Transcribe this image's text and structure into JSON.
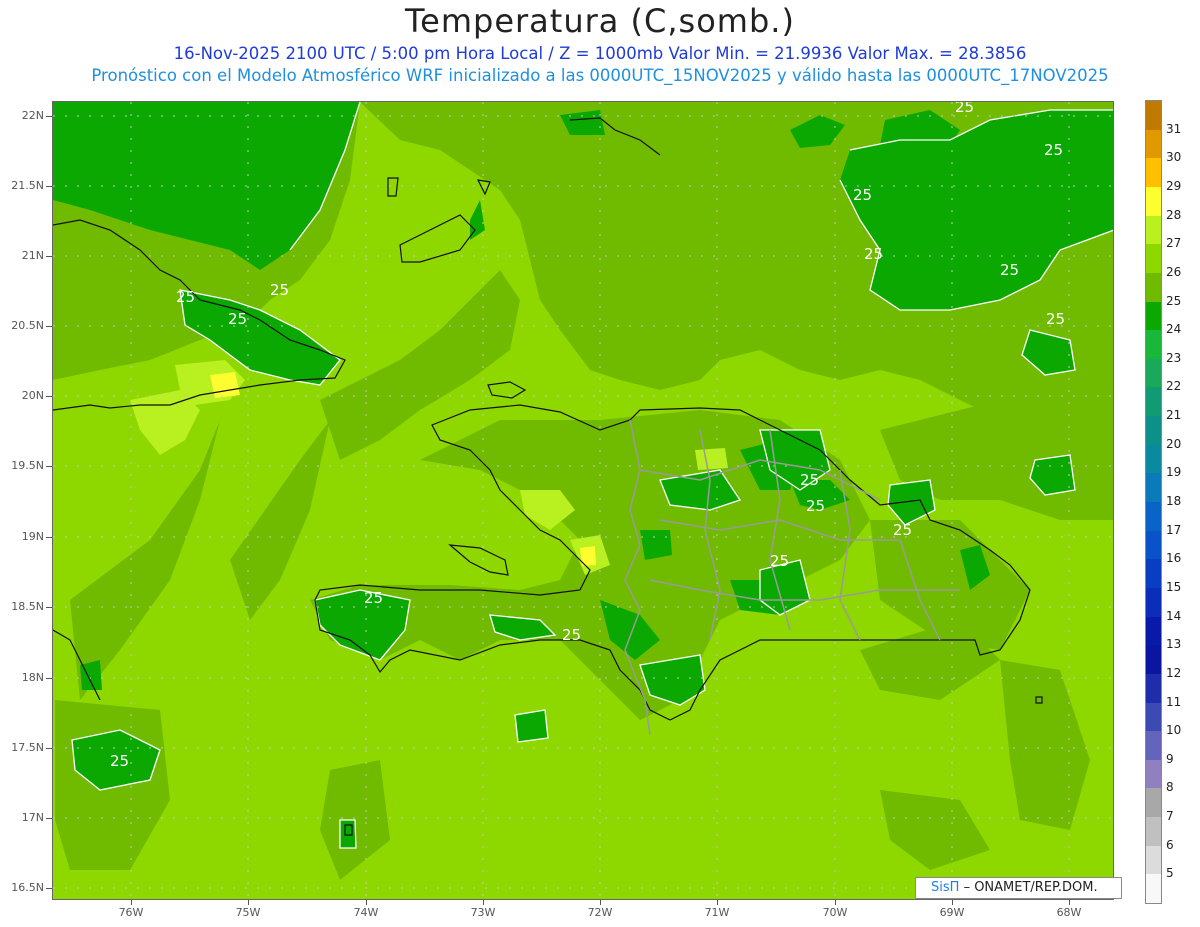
{
  "header": {
    "title": "Temperatura (C,somb.)",
    "line1": "16-Nov-2025  2100 UTC / 5:00 pm Hora Local / Z = 1000mb   Valor Min. = 21.9936  Valor Max. = 28.3856",
    "line2": "Pronóstico con el Modelo Atmosférico WRF inicializado a las 0000UTC_15NOV2025 y válido hasta las  0000UTC_17NOV2025"
  },
  "axes": {
    "y_labels": [
      "22N",
      "21.5N",
      "21N",
      "20.5N",
      "20N",
      "19.5N",
      "19N",
      "18.5N",
      "18N",
      "17.5N",
      "17N",
      "16.5N"
    ],
    "x_labels": [
      "76W",
      "75W",
      "74W",
      "73W",
      "72W",
      "71W",
      "70W",
      "69W",
      "68W"
    ]
  },
  "contour_labels": [
    "25",
    "25",
    "25",
    "25",
    "25",
    "25",
    "25",
    "25",
    "25",
    "25",
    "25",
    "25",
    "25",
    "25"
  ],
  "colorbar": {
    "labels": [
      "31",
      "30",
      "29",
      "28",
      "27",
      "26",
      "25",
      "24",
      "23",
      "22",
      "21",
      "20",
      "19",
      "18",
      "17",
      "16",
      "15",
      "14",
      "13",
      "12",
      "11",
      "10",
      "9",
      "8",
      "7",
      "6",
      "5"
    ],
    "colors": [
      "#c07a00",
      "#e09a00",
      "#ffc000",
      "#ffff30",
      "#b8f020",
      "#8ed800",
      "#70ba00",
      "#0aa800",
      "#1ab83a",
      "#1aa85a",
      "#129a72",
      "#0c9088",
      "#0a8aa0",
      "#0a7ab8",
      "#0a64c8",
      "#0a52c8",
      "#0a3ec0",
      "#0a2eb8",
      "#0a1aa8",
      "#0a16a0",
      "#1e2eaa",
      "#3c4ab4",
      "#6464bc",
      "#9080c0",
      "#a8a8a8",
      "#c0c0c0",
      "#dcdcdc",
      "#f8f8f8"
    ]
  },
  "credit": {
    "logo": "SisΠ",
    "text": "– ONAMET/REP.DOM."
  }
}
